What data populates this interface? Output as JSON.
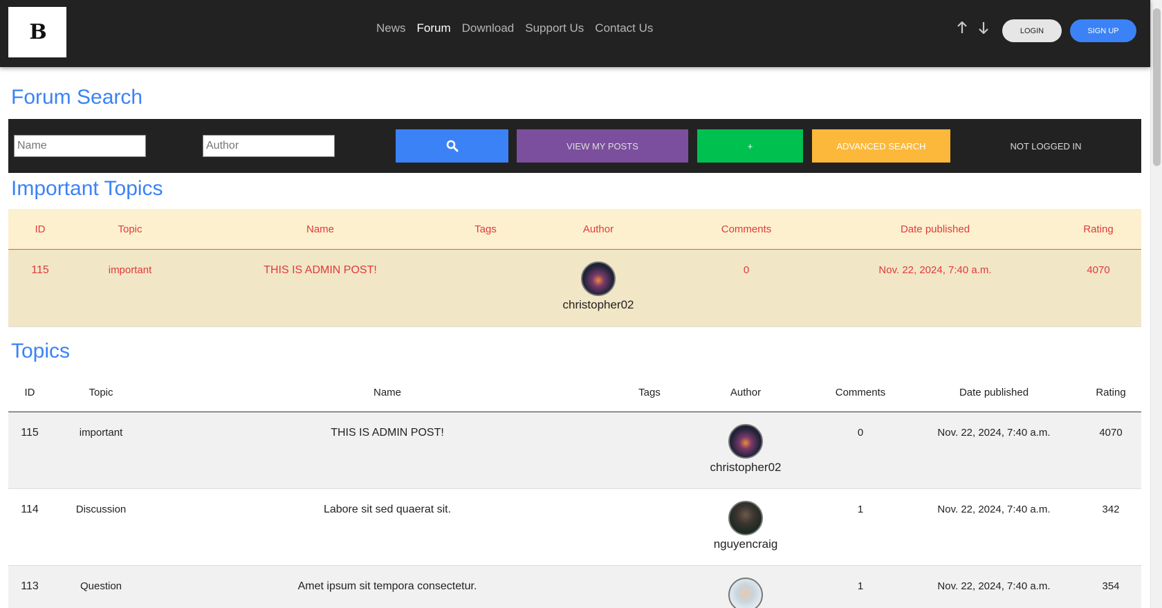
{
  "header": {
    "logo_text": "B",
    "nav": [
      "News",
      "Forum",
      "Download",
      "Support Us",
      "Contact Us"
    ],
    "active_nav": "Forum",
    "login_label": "LOGIN",
    "signup_label": "SIGN UP",
    "accent_color": "#3b82f6"
  },
  "search": {
    "title": "Forum Search",
    "name_placeholder": "Name",
    "author_placeholder": "Author",
    "view_my_posts_label": "VIEW MY POSTS",
    "add_label": "+",
    "advanced_search_label": "ADVANCED SEARCH",
    "status_label": "NOT LOGGED IN"
  },
  "important": {
    "title": "Important Topics",
    "columns": [
      "ID",
      "Topic",
      "Name",
      "Tags",
      "Author",
      "Comments",
      "Date published",
      "Rating"
    ],
    "rows": [
      {
        "id": "115",
        "topic": "important",
        "name": "THIS IS ADMIN POST!",
        "tags": "",
        "author": "christopher02",
        "avatar": "storm",
        "comments": "0",
        "date": "Nov. 22, 2024, 7:40 a.m.",
        "rating": "4070"
      }
    ]
  },
  "topics": {
    "title": "Topics",
    "columns": [
      "ID",
      "Topic",
      "Name",
      "Tags",
      "Author",
      "Comments",
      "Date published",
      "Rating"
    ],
    "rows": [
      {
        "id": "115",
        "topic": "important",
        "name": "THIS IS ADMIN POST!",
        "tags": "",
        "author": "christopher02",
        "avatar": "storm",
        "comments": "0",
        "date": "Nov. 22, 2024, 7:40 a.m.",
        "rating": "4070"
      },
      {
        "id": "114",
        "topic": "Discussion",
        "name": "Labore sit sed quaerat sit.",
        "tags": "",
        "author": "nguyencraig",
        "avatar": "man",
        "comments": "1",
        "date": "Nov. 22, 2024, 7:40 a.m.",
        "rating": "342"
      },
      {
        "id": "113",
        "topic": "Question",
        "name": "Amet ipsum sit tempora consectetur.",
        "tags": "",
        "author": "",
        "avatar": "light",
        "comments": "1",
        "date": "Nov. 22, 2024, 7:40 a.m.",
        "rating": "354"
      }
    ]
  }
}
